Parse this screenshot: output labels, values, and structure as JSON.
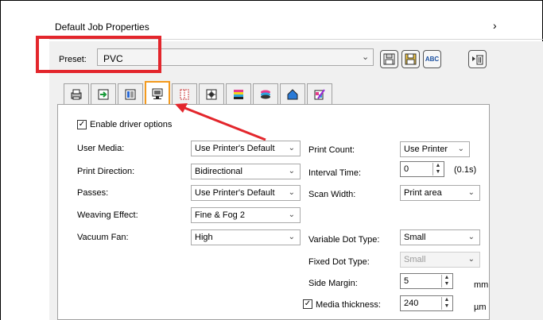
{
  "window": {
    "title": "Default Job Properties",
    "chevron": "›"
  },
  "preset": {
    "label": "Preset:",
    "value": "PVC"
  },
  "toolbar": {
    "buttons": [
      "save-icon",
      "save-as-icon",
      "rename-icon",
      "delete-icon"
    ],
    "rename_text": "ABC"
  },
  "tabs": [
    "printer-icon",
    "media-feed-icon",
    "color-icon",
    "print-mode-icon",
    "layout-icon",
    "positioning-icon",
    "color-bars-icon",
    "ink-layer-icon",
    "shape-icon",
    "spot-color-icon"
  ],
  "annotation_color": "#e3262c",
  "options": {
    "enable_label": "Enable driver options",
    "user_media": {
      "label": "User Media:",
      "value": "Use Printer's Default"
    },
    "print_direction": {
      "label": "Print Direction:",
      "value": "Bidirectional"
    },
    "passes": {
      "label": "Passes:",
      "value": "Use Printer's Default"
    },
    "weaving_effect": {
      "label": "Weaving Effect:",
      "value": "Fine & Fog 2"
    },
    "vacuum_fan": {
      "label": "Vacuum Fan:",
      "value": "High"
    },
    "print_count": {
      "label": "Print Count:",
      "value": "Use Printer"
    },
    "interval_time": {
      "label": "Interval Time:",
      "value": "0",
      "unit": "(0.1s)"
    },
    "scan_width": {
      "label": "Scan Width:",
      "value": "Print area"
    },
    "variable_dot": {
      "label": "Variable Dot Type:",
      "value": "Small"
    },
    "fixed_dot": {
      "label": "Fixed Dot Type:",
      "value": "Small"
    },
    "side_margin": {
      "label": "Side Margin:",
      "value": "5",
      "unit": "mm"
    },
    "media_thickness": {
      "label": "Media thickness:",
      "value": "240",
      "unit": "µm"
    }
  }
}
